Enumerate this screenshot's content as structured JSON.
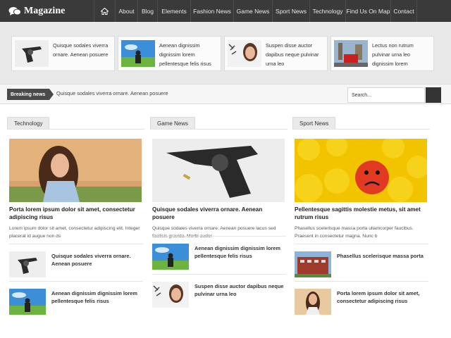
{
  "header": {
    "logo_text": "Magazine",
    "nav": [
      "About",
      "Blog",
      "Elements",
      "Fashion News",
      "Game News",
      "Sport News",
      "Technology",
      "Find Us On Map",
      "Contact"
    ]
  },
  "featured": [
    {
      "title": "Quisque sodales viverra ornare. Aenean posuere"
    },
    {
      "title": "Aenean dignissim dignissim lorem pellentesque felis risus"
    },
    {
      "title": "Suspen disse auctor dapibus neque pulvinar urna leo"
    },
    {
      "title": "Lectus non rutrum pulvinar urna leo dignissim lorem"
    }
  ],
  "breaking": {
    "label": "Breaking news",
    "text": "Quisque sodales viverra ornare. Aenean posuere",
    "search_placeholder": "Search..."
  },
  "columns": [
    {
      "tab": "Technology",
      "main_title": "Porta lorem ipsum dolor sit amet, consectetur adipiscing risus",
      "main_excerpt": "Lorem ipsum dolor sit amet, consectetur adipiscing elit. Integer placerat id augue non ds",
      "items": [
        "Quisque sodales viverra ornare. Aenean posuere",
        "Aenean dignissim dignissim lorem pellentesque felis risus"
      ]
    },
    {
      "tab": "Game News",
      "main_title": "Quisque sodales viverra ornare. Aenean posuere",
      "main_excerpt": "Quisque sodales viverra ornare. Aenean posuere lacus sed facilisis gravida. Morbi audor",
      "items": [
        "Aenean dignissim dignissim lorem pellentesque felis risus",
        "Suspen disse auctor dapibus neque pulvinar urna leo"
      ]
    },
    {
      "tab": "Sport News",
      "main_title": "Pellentesque sagittis molestie metus, sit amet rutrum risus",
      "main_excerpt": "Phasellus scelerisque massa porta ullamcorper faucibus. Praesent in consectetur magna. Nunc b",
      "items": [
        "Phasellus scelerisque massa porta",
        "Porta lorem ipsum dolor sit amet, consectetur adipiscing risus"
      ]
    }
  ],
  "colors": {
    "nav_bg": "#3a3a3a",
    "featured_bg": "#e9e9e9",
    "breaking_label_bg": "#4a4a4a"
  },
  "icons": [
    "chat-bubble-icon",
    "home-icon"
  ]
}
